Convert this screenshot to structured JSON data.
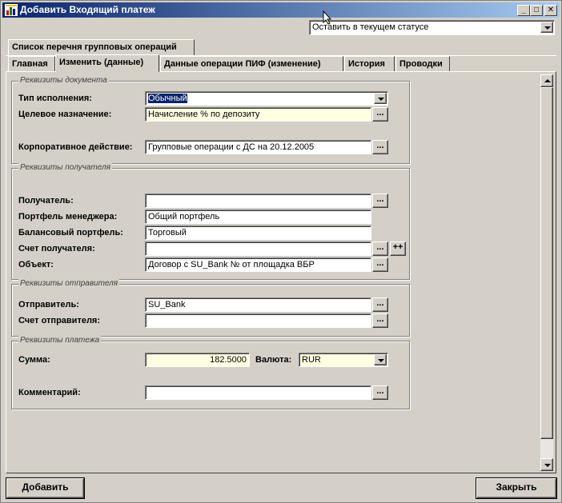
{
  "window": {
    "title": "Добавить Входящий платеж",
    "controls": {
      "minimize": "_",
      "maximize": "□",
      "close": "✕"
    }
  },
  "status_select": {
    "value": "Оставить в текущем статусе"
  },
  "upper_tab": {
    "label": "Список перечня групповых операций"
  },
  "tabs": [
    {
      "label": "Главная"
    },
    {
      "label": "Изменить (данные)"
    },
    {
      "label": "Данные операции ПИФ (изменение)"
    },
    {
      "label": "История"
    },
    {
      "label": "Проводки"
    }
  ],
  "groups": {
    "document": {
      "title": "Реквизиты документа",
      "exec_type_label": "Тип исполнения:",
      "exec_type_value": "Обычный",
      "purpose_label": "Целевое назначение:",
      "purpose_value": "Начисление % по депозиту",
      "corp_action_label": "Корпоративное действие:",
      "corp_action_value": "Групповые операции с ДС на 20.12.2005"
    },
    "recipient": {
      "title": "Реквизиты получателя",
      "recipient_label": "Получатель:",
      "recipient_value": "",
      "manager_portfolio_label": "Портфель менеджера:",
      "manager_portfolio_value": "Общий портфель",
      "balance_portfolio_label": "Балансовый портфель:",
      "balance_portfolio_value": "Торговый",
      "account_label": "Счет получателя:",
      "account_value": "",
      "object_label": "Объект:",
      "object_value": "Договор с SU_Bank №  от  площадка ВБР"
    },
    "sender": {
      "title": "Реквизиты отправителя",
      "sender_label": "Отправитель:",
      "sender_value": "SU_Bank",
      "account_label": "Счет отправителя:",
      "account_value": ""
    },
    "payment": {
      "title": "Реквизиты платежа",
      "amount_label": "Сумма:",
      "amount_value": "182.5000",
      "currency_label": "Валюта:",
      "currency_value": "RUR",
      "comment_label": "Комментарий:",
      "comment_value": ""
    }
  },
  "buttons": {
    "dots": "...",
    "plus": "++",
    "add": "Добавить",
    "close": "Закрыть"
  },
  "colors": {
    "titlebar_start": "#0a246a",
    "titlebar_end": "#a6caf0",
    "face": "#d4d0c8",
    "field_yellow": "#ffffe1",
    "selection": "#0a246a"
  }
}
